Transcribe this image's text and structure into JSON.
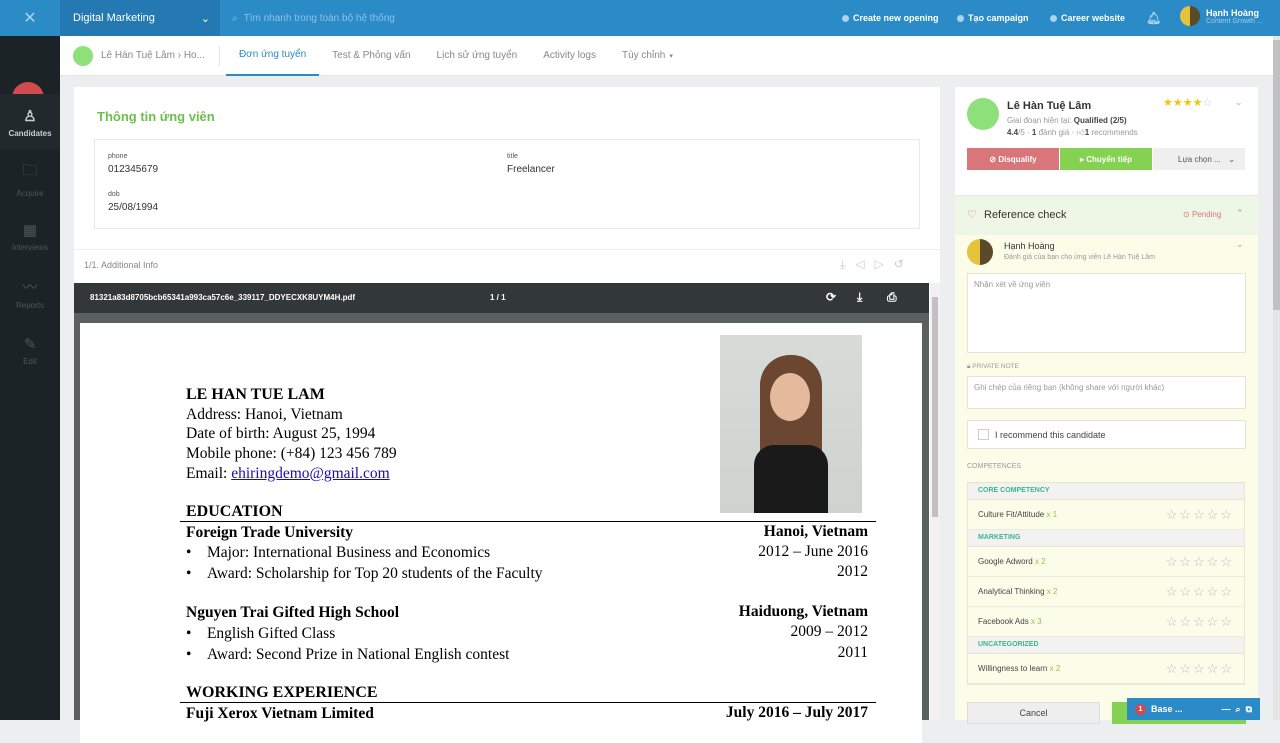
{
  "topbar": {
    "workspace": "Digital Marketing",
    "search_placeholder": "Tìm nhanh trong toàn bộ hệ thống",
    "links": [
      "Create new opening",
      "Tạo campaign",
      "Career website"
    ],
    "user_name": "Hạnh Hoàng",
    "user_role": "Content Growth ..."
  },
  "sidebar": {
    "items": [
      {
        "label": "Candidates",
        "icon": "user-check-icon"
      },
      {
        "label": "Acquire",
        "icon": "folder-plus-icon"
      },
      {
        "label": "Interviews",
        "icon": "calendar-icon"
      },
      {
        "label": "Reports",
        "icon": "chart-line-icon"
      },
      {
        "label": "Edit",
        "icon": "edit-icon"
      }
    ]
  },
  "subnav": {
    "breadcrumb": "Lê Hàn Tuệ Lâm › Ho...",
    "tabs": [
      "Đơn ứng tuyển",
      "Test & Phỏng vấn",
      "Lịch sử ứng tuyển",
      "Activity logs",
      "Tùy chỉnh"
    ],
    "active_tab": "Đơn ứng tuyển"
  },
  "info": {
    "title": "Thông tin ứng viên",
    "fields": [
      {
        "label": "phone",
        "value": "012345679"
      },
      {
        "label": "title",
        "value": "Freelancer"
      },
      {
        "label": "dob",
        "value": "25/08/1994"
      }
    ]
  },
  "attachment": {
    "label": "1/1. Additional Info",
    "filename": "81321a83d8705bcb65341a993ca57c6e_339117_DDYECXK8UYM4H.pdf",
    "pages": "1 / 1"
  },
  "cv": {
    "name": "LE HAN TUE LAM",
    "address": "Address: Hanoi, Vietnam",
    "dob": "Date of birth: August 25, 1994",
    "phone": "Mobile phone: (+84) 123 456 789",
    "email_label": "Email: ",
    "email": "ehiringdemo@gmail.com",
    "education_heading": "EDUCATION",
    "school1": "Foreign Trade University",
    "school1_loc": "Hanoi, Vietnam",
    "school1_b1": "Major: International Business and Economics",
    "school1_d1": "2012 – June 2016",
    "school1_b2": "Award: Scholarship for Top 20 students of the Faculty",
    "school1_d2": "2012",
    "school2": "Nguyen Trai Gifted High School",
    "school2_loc": "Haiduong, Vietnam",
    "school2_b1": "English Gifted Class",
    "school2_d1": "2009 – 2012",
    "school2_b2": "Award: Second Prize in National English contest",
    "school2_d2": "2011",
    "work_heading": "WORKING EXPERIENCE",
    "job1": "Fuji Xerox Vietnam Limited",
    "job1_date": "July 2016 – July 2017"
  },
  "candidate": {
    "name": "Lê Hàn Tuệ Lâm",
    "stage_label": "Giai đoạn hiện tại: ",
    "stage": "Qualified (2/5)",
    "score": "4.4",
    "score_suffix": "/5 · ",
    "reviews_count": "1",
    "reviews_label": " đánh giá · ",
    "recommends_count": "1",
    "recommends_label": " recommends",
    "rating": 4,
    "rating_max": 5,
    "disqualify": "Disqualify",
    "next": "Chuyển tiếp",
    "options": "Lựa chọn ..."
  },
  "reference": {
    "title": "Reference check",
    "status": "Pending",
    "reviewer": "Hạnh Hoàng",
    "reviewer_sub": "Đánh giá của bạn cho ứng viên Lê Hàn Tuệ Lâm",
    "comment_placeholder": "Nhận xét về ứng viên",
    "private_label": "PRIVATE NOTE",
    "private_placeholder": "Ghi chép của riêng bạn (không share với người khác)",
    "recommend": "I recommend this candidate",
    "competences_label": "COMPETENCES",
    "groups": [
      {
        "name": "CORE COMPETENCY",
        "items": [
          {
            "name": "Culture Fit/Attitude",
            "weight": "x 1"
          }
        ]
      },
      {
        "name": "MARKETING",
        "items": [
          {
            "name": "Google Adword",
            "weight": "x 2"
          },
          {
            "name": "Analytical Thinking",
            "weight": "x 2"
          },
          {
            "name": "Facebook Ads",
            "weight": "x 3"
          }
        ]
      },
      {
        "name": "UNCATEGORIZED",
        "items": [
          {
            "name": "Willingness to learn",
            "weight": "x 2"
          }
        ]
      }
    ],
    "cancel": "Cancel"
  },
  "chat": {
    "badge": "1",
    "label": "Base ..."
  },
  "colors": {
    "primary": "#2b8bc6",
    "green": "#6cc04a",
    "danger": "#d9767a",
    "sidebar": "#1b2326"
  }
}
